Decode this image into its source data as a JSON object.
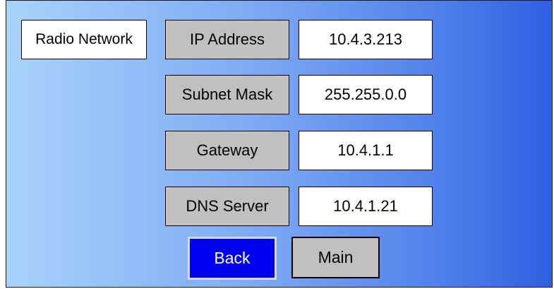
{
  "screen": {
    "title": "Radio Network"
  },
  "fields": [
    {
      "label": "IP Address",
      "value": "10.4.3.213"
    },
    {
      "label": "Subnet Mask",
      "value": "255.255.0.0"
    },
    {
      "label": "Gateway",
      "value": "10.4.1.1"
    },
    {
      "label": "DNS Server",
      "value": "10.4.1.21"
    }
  ],
  "buttons": {
    "back": "Back",
    "main": "Main"
  },
  "colors": {
    "gradient_start": "#a9d2fb",
    "gradient_end": "#2f5fe2",
    "label_background": "#c0c0c0",
    "value_background": "#ffffff",
    "back_button": "#0000f0"
  }
}
